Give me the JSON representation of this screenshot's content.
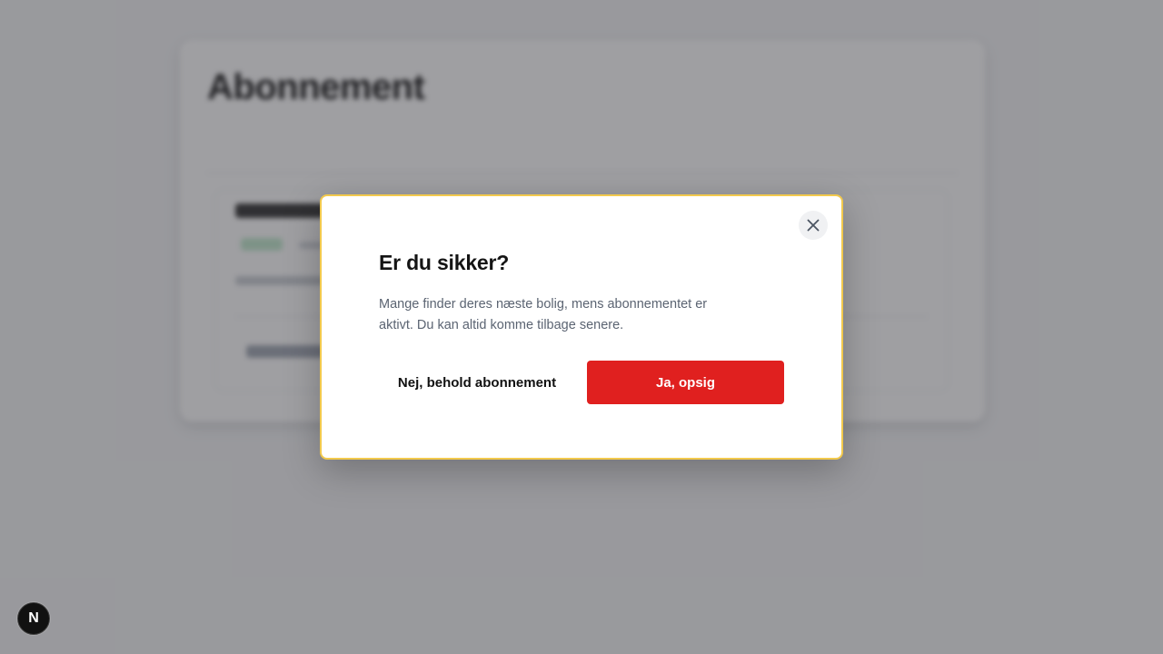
{
  "background": {
    "page_title": "Abonnement"
  },
  "modal": {
    "title": "Er du sikker?",
    "body": "Mange finder deres næste bolig, mens abonnementet er aktivt. Du kan altid komme tilbage senere.",
    "keep_label": "Nej, behold abonnement",
    "confirm_label": "Ja, opsig",
    "close_icon": "close-icon"
  },
  "dev_badge": {
    "letter": "N"
  },
  "colors": {
    "confirm": "#e0201f",
    "modal_border": "#f2c94c",
    "body_text": "#5b6472"
  }
}
